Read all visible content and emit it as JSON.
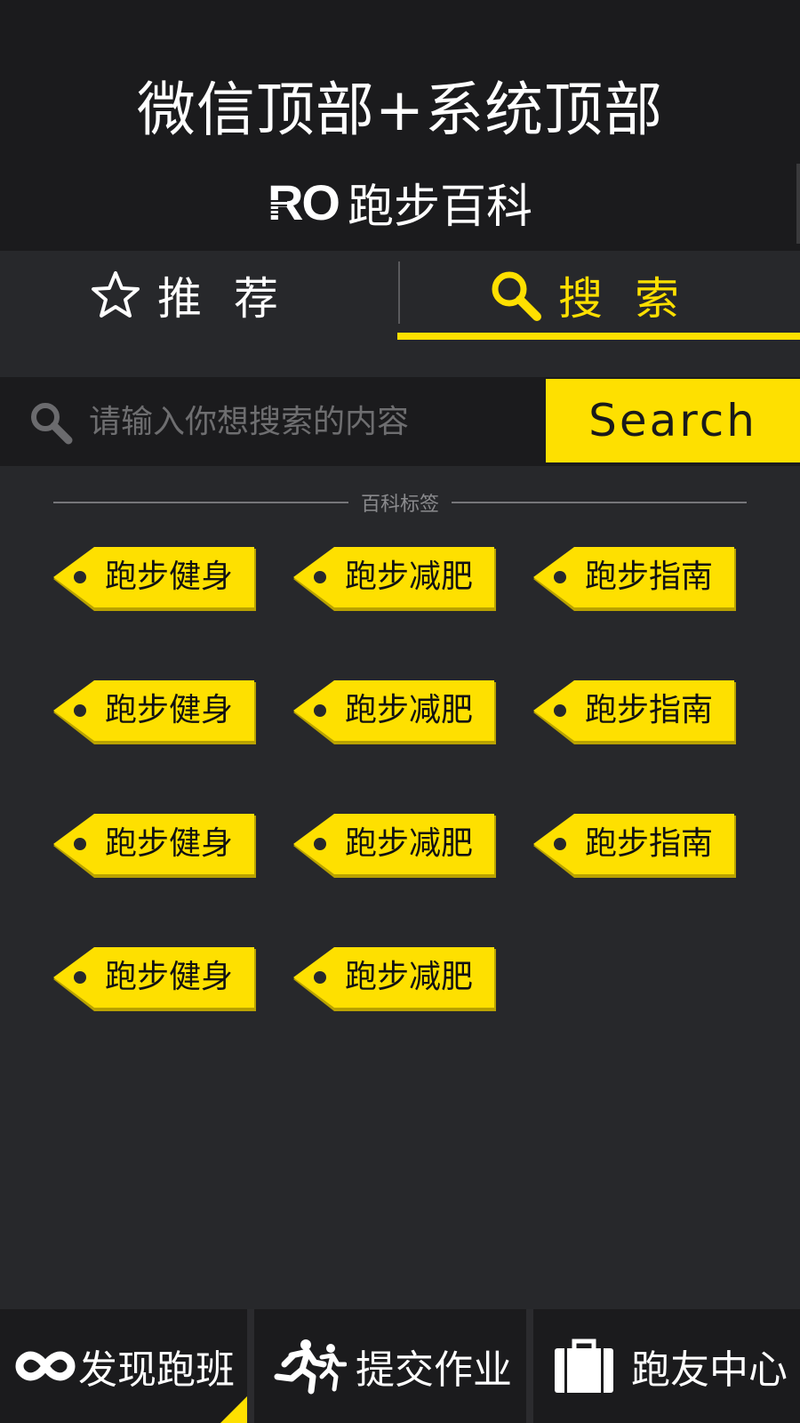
{
  "system_header": {
    "title": "微信顶部+系统顶部"
  },
  "brand": {
    "logo_text": "RO",
    "name": "跑步百科"
  },
  "tabs": [
    {
      "label": "推荐",
      "icon": "star-icon",
      "active": false
    },
    {
      "label": "搜索",
      "icon": "search-icon",
      "active": true
    }
  ],
  "search": {
    "placeholder": "请输入你想搜索的内容",
    "button_label": "Search"
  },
  "section": {
    "heading": "百科标签"
  },
  "tags": [
    {
      "label": "跑步健身"
    },
    {
      "label": "跑步减肥"
    },
    {
      "label": "跑步指南"
    },
    {
      "label": "跑步健身"
    },
    {
      "label": "跑步减肥"
    },
    {
      "label": "跑步指南"
    },
    {
      "label": "跑步健身"
    },
    {
      "label": "跑步减肥"
    },
    {
      "label": "跑步指南"
    },
    {
      "label": "跑步健身"
    },
    {
      "label": "跑步减肥"
    }
  ],
  "bottom_nav": [
    {
      "label": "发现跑班",
      "icon": "infinity-icon",
      "active": true
    },
    {
      "label": "提交作业",
      "icon": "runners-icon",
      "active": false
    },
    {
      "label": "跑友中心",
      "icon": "briefcase-icon",
      "active": false
    }
  ],
  "colors": {
    "accent": "#fee000",
    "background": "#27282b",
    "header_background": "#1b1b1d"
  }
}
